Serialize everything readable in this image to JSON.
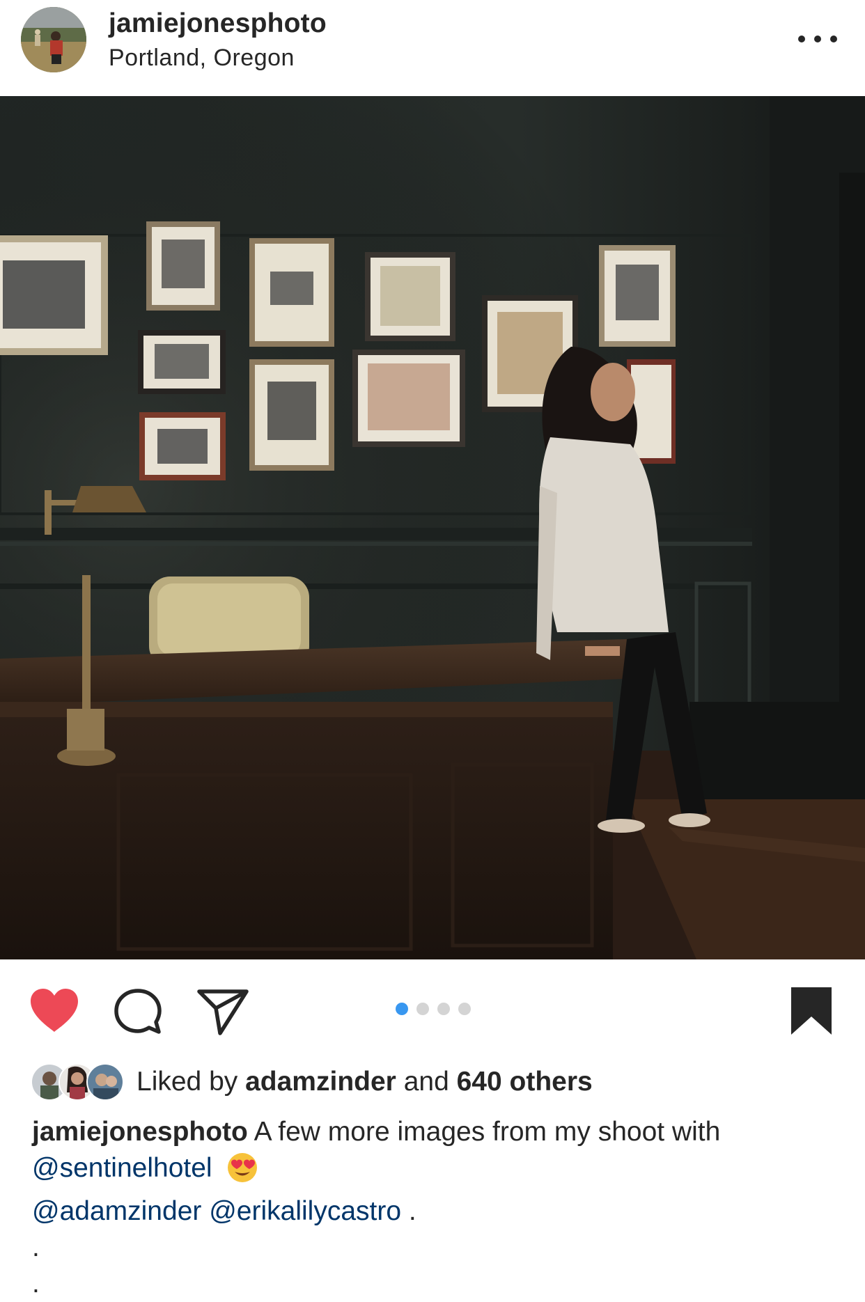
{
  "post": {
    "author": {
      "username": "jamiejonesphoto",
      "location": "Portland, Oregon"
    },
    "carousel": {
      "count": 4,
      "active_index": 0
    },
    "liked": true,
    "saved": true,
    "likes": {
      "prefix": "Liked by",
      "user": "adamzinder",
      "joiner": "and",
      "others": "640 others"
    },
    "caption": {
      "username": "jamiejonesphoto",
      "text": "A few more images from my shoot with",
      "mention_1": "@sentinelhotel",
      "emoji": "heart-eyes-emoji",
      "mention_2": "@adamzinder",
      "mention_3": "@erikalilycastro",
      "trailing": ".",
      "extra_line_1": ".",
      "extra_line_2": "."
    }
  },
  "colors": {
    "like_red": "#ed4956",
    "mention_blue": "#003569",
    "carousel_active": "#3897f0",
    "carousel_inactive": "#d4d4d4"
  },
  "icons": {
    "more": "more-options-icon",
    "like": "heart-icon",
    "comment": "comment-icon",
    "share": "share-icon",
    "save": "bookmark-icon"
  }
}
